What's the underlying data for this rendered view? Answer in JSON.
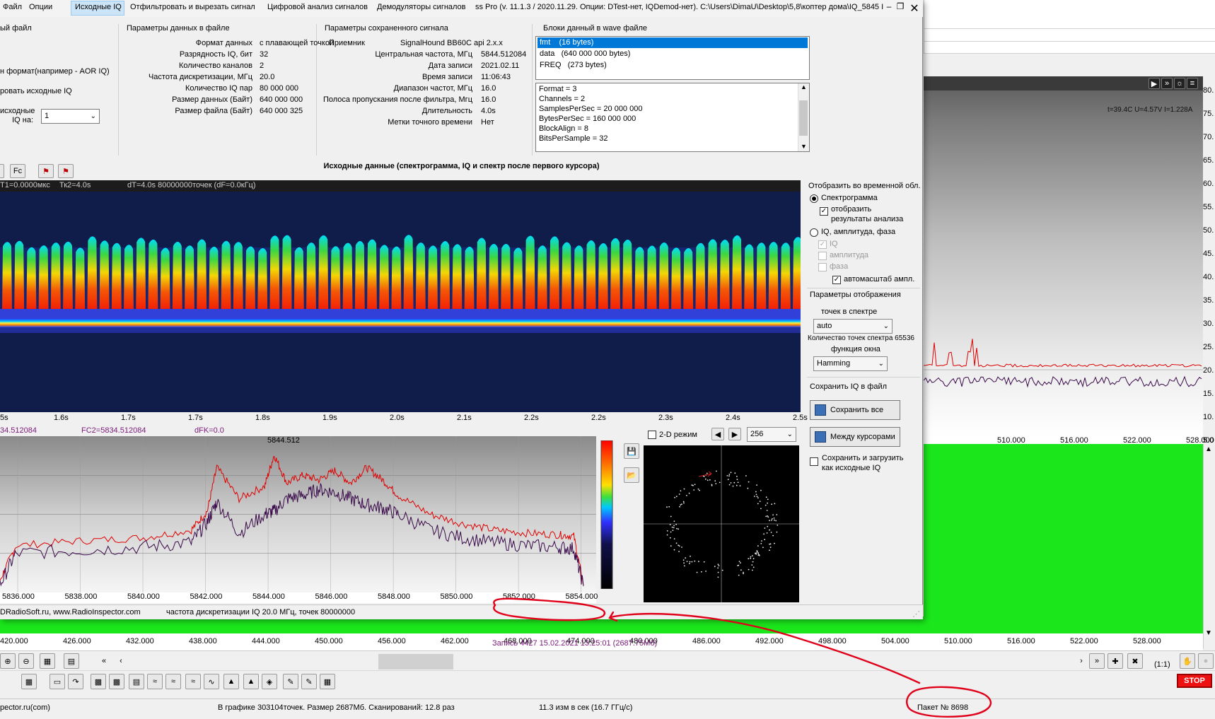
{
  "menu": {
    "file": "Файл",
    "options": "Опции",
    "source_iq": "Исходные IQ",
    "filter_cut": "Отфильтровать и вырезать сигнал",
    "digital_analysis": "Цифровой анализ сигналов",
    "demodulators": "Демодуляторы сигналов"
  },
  "window_title": "ss Pro (v. 11.1.3 / 2020.11.29. Опции: DTest-нет, IQDemod-нет). C:\\Users\\DimaU\\Desktop\\5,8\\коптер дома\\IQ_5845 I",
  "left_group": {
    "title": "ый файл",
    "line1": "н формат(например - AOR IQ)",
    "line2": "ровать исходные IQ",
    "line3": "исходные",
    "line4": "IQ на:",
    "select_value": "1"
  },
  "file_params": {
    "title": "Параметры данных в файле",
    "rows": [
      {
        "label": "Формат данных",
        "value": "с плавающей точкой"
      },
      {
        "label": "Разрядность IQ, бит",
        "value": "32"
      },
      {
        "label": "Количество каналов",
        "value": "2"
      },
      {
        "label": "Частота дискретизации, МГц",
        "value": "20.0"
      },
      {
        "label": "Количество IQ пар",
        "value": "80 000 000"
      },
      {
        "label": "Размер данных (Байт)",
        "value": "640 000 000"
      },
      {
        "label": "Размер файла (Байт)",
        "value": "640 000 325"
      }
    ]
  },
  "saved_params": {
    "title": "Параметры сохраненного сигнала",
    "receiver_label": "Приемник",
    "receiver_value": "SignalHound BB60C api 2.x.x",
    "rows": [
      {
        "label": "Центральная частота, МГц",
        "value": "5844.512084"
      },
      {
        "label": "Дата записи",
        "value": "2021.02.11"
      },
      {
        "label": "Время записи",
        "value": "11:06:43"
      },
      {
        "label": "Диапазон частот, МГц",
        "value": "16.0"
      },
      {
        "label": "Полоса пропускания после фильтра, Мгц",
        "value": "16.0"
      },
      {
        "label": "Длительность",
        "value": "4.0s"
      },
      {
        "label": "Метки точного времени",
        "value": "Нет"
      }
    ]
  },
  "wave_blocks": {
    "title": "Блоки данный в wave файле",
    "items": [
      "fmt    (16 bytes)",
      "data   (640 000 000 bytes)",
      "FREQ   (273 bytes)"
    ],
    "details": [
      "Format = 3",
      "Channels = 2",
      "SamplesPerSec = 20 000 000",
      "BytesPerSec = 160 000 000",
      "BlockAlign = 8",
      "BitsPerSample = 32"
    ]
  },
  "section_title": "Исходные данные (спектрограмма, IQ и спектр после первого курсора)",
  "spectrogram": {
    "h1": "Т1=0.0000мкс",
    "h2": "Тк2=4.0s",
    "h3": "dT=4.0s   80000000точек (dF=0.0кГц)",
    "axis": [
      "5s",
      "1.6s",
      "1.7s",
      "1.7s",
      "1.8s",
      "1.9s",
      "2.0s",
      "2.1s",
      "2.2s",
      "2.2s",
      "2.3s",
      "2.4s",
      "2.5s"
    ]
  },
  "spectrum": {
    "fc1": "34.512084",
    "fc2": "FC2=5834.512084",
    "dfk": "dFK=0.0",
    "peak_label": "5844.512",
    "axis": [
      "5836.000",
      "5838.000",
      "5840.000",
      "5842.000",
      "5844.000",
      "5846.000",
      "5848.000",
      "5850.000",
      "5852.000",
      "5854.000"
    ]
  },
  "constellation": {
    "mode_label": "2-D режим",
    "points_value": "256"
  },
  "settings": {
    "show_title": "Отобразить во временной обл.",
    "spectrogram": "Спектрограмма",
    "show_results_1": "отобразить",
    "show_results_2": "результаты анализа",
    "iq_amp_phase": "IQ, амплитуда, фаза",
    "iq": "IQ",
    "amplitude": "амплитуда",
    "phase": "фаза",
    "autoscale": "автомасштаб ампл.",
    "display_params": "Параметры отображения",
    "points_in_spectrum": "точек в спектре",
    "points_value": "auto",
    "points_count": "Количество точек спектра 65536",
    "window_func": "функция окна",
    "window_value": "Hamming",
    "save_title": "Сохранить IQ в файл",
    "save_all": "Сохранить все",
    "between_cursors": "Между курсорами",
    "save_load_1": "Сохранить и загрузить",
    "save_load_2": "как исходные IQ"
  },
  "dialog_status": {
    "site": "DRadioSoft.ru, www.RadioInspector.com",
    "info": "частота дискретизации IQ 20.0 МГц, точек 80000000"
  },
  "background": {
    "readout": "t=39.4C U=4.57V I=1.228A",
    "y_axis": [
      "80.",
      "75.",
      "70.",
      "65.",
      "60.",
      "55.",
      "50.",
      "45.",
      "40.",
      "35.",
      "30.",
      "25.",
      "20.",
      "15.",
      "10.",
      "5.0"
    ],
    "upper_axis": [
      "510.000",
      "516.000",
      "522.000",
      "528.000"
    ],
    "lower_axis": [
      "420.000",
      "426.000",
      "432.000",
      "438.000",
      "444.000",
      "450.000",
      "456.000",
      "462.000",
      "468.000",
      "474.000",
      "480.000",
      "486.000",
      "492.000",
      "498.000",
      "504.000",
      "510.000",
      "516.000",
      "522.000",
      "528.000"
    ],
    "record": "Запись 4427 15.02.2021 13:25:01 (2687.75Мб)",
    "scale": "(1:1)",
    "stop": "STOP"
  },
  "status_bar": {
    "site": "pector.ru(com)",
    "graph": "В графике 303104точек.  Размер 2687Мб. Сканирований: 12.8 раз",
    "rate": "11.3 изм в сек (16.7 ГГц/с)",
    "packet": "Пакет № 8698"
  },
  "chart_data": [
    {
      "type": "line",
      "x_range": [
        5835.5,
        5854.2
      ],
      "ylim": [
        0,
        100
      ],
      "xlabel": "",
      "ylabel": "",
      "series": [
        {
          "color": "#e00000",
          "x": [
            5835.5,
            5836,
            5838,
            5840,
            5841.5,
            5842,
            5842.3,
            5843,
            5843.8,
            5844.1,
            5844.5,
            5845,
            5845.5,
            5846,
            5846.5,
            5847,
            5847.5,
            5848,
            5849,
            5850,
            5851,
            5852,
            5853,
            5853.5,
            5853.8
          ],
          "values": [
            8,
            30,
            33,
            35,
            40,
            52,
            80,
            60,
            68,
            88,
            70,
            75,
            72,
            78,
            70,
            80,
            72,
            62,
            50,
            44,
            40,
            38,
            37,
            36,
            5
          ]
        },
        {
          "color": "#3a0a4a",
          "x": [
            5835.5,
            5836,
            5838,
            5840,
            5841.5,
            5842,
            5842.3,
            5843,
            5843.8,
            5844.1,
            5844.5,
            5845,
            5845.5,
            5846,
            5846.5,
            5847,
            5847.5,
            5848,
            5849,
            5850,
            5851,
            5852,
            5853,
            5853.5,
            5853.8
          ],
          "values": [
            5,
            25,
            27,
            29,
            32,
            45,
            58,
            38,
            50,
            52,
            60,
            62,
            66,
            64,
            60,
            56,
            54,
            50,
            40,
            35,
            32,
            30,
            29,
            28,
            4
          ]
        }
      ]
    }
  ]
}
